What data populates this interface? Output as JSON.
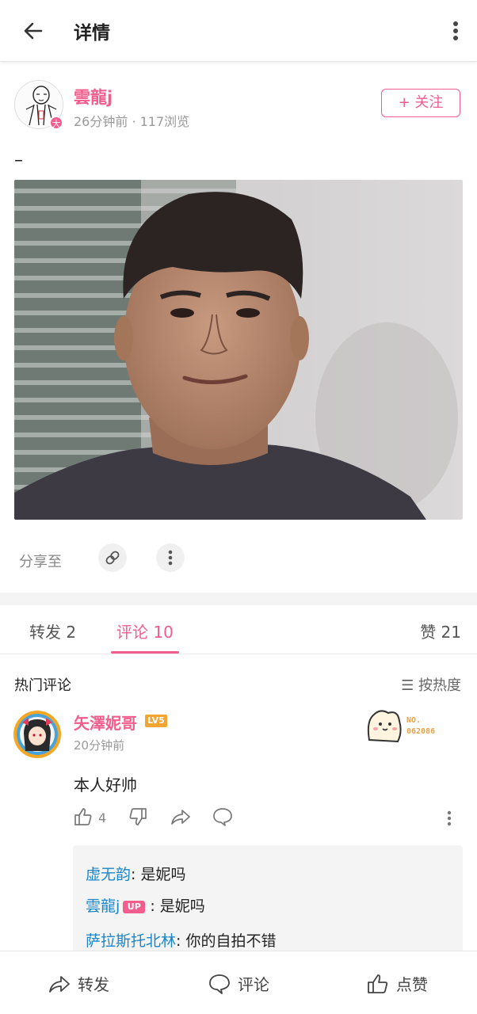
{
  "header": {
    "title": "详情"
  },
  "author": {
    "name": "雲龍j",
    "meta": "26分钟前 · 117浏览",
    "badge": "大",
    "follow_label": "+ 关注"
  },
  "post": {
    "text": "–"
  },
  "share": {
    "label": "分享至"
  },
  "tabs": {
    "repost": "转发 2",
    "comment": "评论 10",
    "like": "赞 21"
  },
  "comments_section": {
    "title": "热门评论",
    "sort_label": "☰ 按热度"
  },
  "comment": {
    "user": "矢澤妮哥",
    "level": "LV5",
    "time": "20分钟前",
    "fan_number_label": "NO.",
    "fan_number": "062086",
    "text": "本人好帅",
    "like_count": "4",
    "replies": [
      {
        "user": "虚无韵",
        "sep": ": ",
        "text": "是妮吗"
      },
      {
        "user": "雲龍j",
        "tag": "UP",
        "sep": " : ",
        "text": "是妮吗"
      },
      {
        "user": "萨拉斯托北林",
        "sep": ": ",
        "text": "你的自拍不错"
      }
    ]
  },
  "bottom_bar": {
    "repost": "转发",
    "comment": "评论",
    "like": "点赞"
  },
  "colors": {
    "accent_pink": "#f25d8e",
    "reply_name_blue": "#1a86c9",
    "level_orange": "#f2a533"
  }
}
